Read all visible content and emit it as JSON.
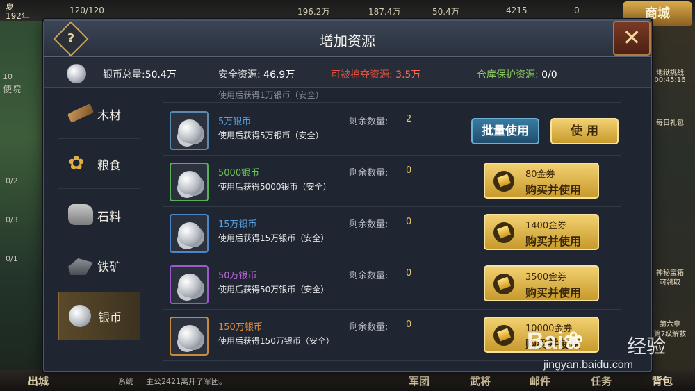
{
  "hud": {
    "season": "夏",
    "year": "192年",
    "hp": "120/120",
    "res1": "196.2万",
    "res2": "187.4万",
    "res3": "50.4万",
    "res4": "4215",
    "res5": "0",
    "shop": "商城",
    "left_counts": [
      "0/2",
      "0/3",
      "0/1"
    ],
    "left_label": "使院",
    "left_badge": "10",
    "right_labels": [
      "地狱挑战",
      "00:45:16",
      "每日礼包",
      "神秘宝箱",
      "可领取",
      "第六章",
      "第7级解救"
    ],
    "bottom": [
      "出城",
      "军团",
      "武将",
      "邮件",
      "任务",
      "背包"
    ],
    "chat_tag": "系统",
    "chat": "主公2421离开了军团。"
  },
  "dialog": {
    "title": "增加资源",
    "help": "?",
    "close": "✕"
  },
  "stats": {
    "total_label": "银币总量:",
    "total_value": "50.4万",
    "safe_label": "安全资源:",
    "safe_value": "46.9万",
    "loot_label": "可被掠夺资源:",
    "loot_value": "3.5万",
    "protect_label": "仓库保护资源:",
    "protect_value": "0/0"
  },
  "sidebar": {
    "items": [
      {
        "label": "木材"
      },
      {
        "label": "粮食"
      },
      {
        "label": "石料"
      },
      {
        "label": "铁矿"
      },
      {
        "label": "银币"
      }
    ]
  },
  "list": {
    "partial_text": "使用后获得1万银币（安全）",
    "qty_label": "剩余数量:",
    "rows": [
      {
        "name": "5万银币",
        "desc": "使用后获得5万银币（安全）",
        "qty": "2",
        "batch": "批量使用",
        "use": "使 用"
      },
      {
        "name": "5000银币",
        "desc": "使用后获得5000银币（安全）",
        "qty": "0",
        "price": "80金券",
        "action": "购买并使用"
      },
      {
        "name": "15万银币",
        "desc": "使用后获得15万银币（安全）",
        "qty": "0",
        "price": "1400金券",
        "action": "购买并使用"
      },
      {
        "name": "50万银币",
        "desc": "使用后获得50万银币（安全）",
        "qty": "0",
        "price": "3500金券",
        "action": "购买并使用"
      },
      {
        "name": "150万银币",
        "desc": "使用后获得150万银币（安全）",
        "qty": "0",
        "price": "10000金券",
        "action": "购买并使用"
      }
    ]
  },
  "watermark": {
    "logo": "Bai",
    "logo_cn": "经验",
    "url": "jingyan.baidu.com"
  }
}
